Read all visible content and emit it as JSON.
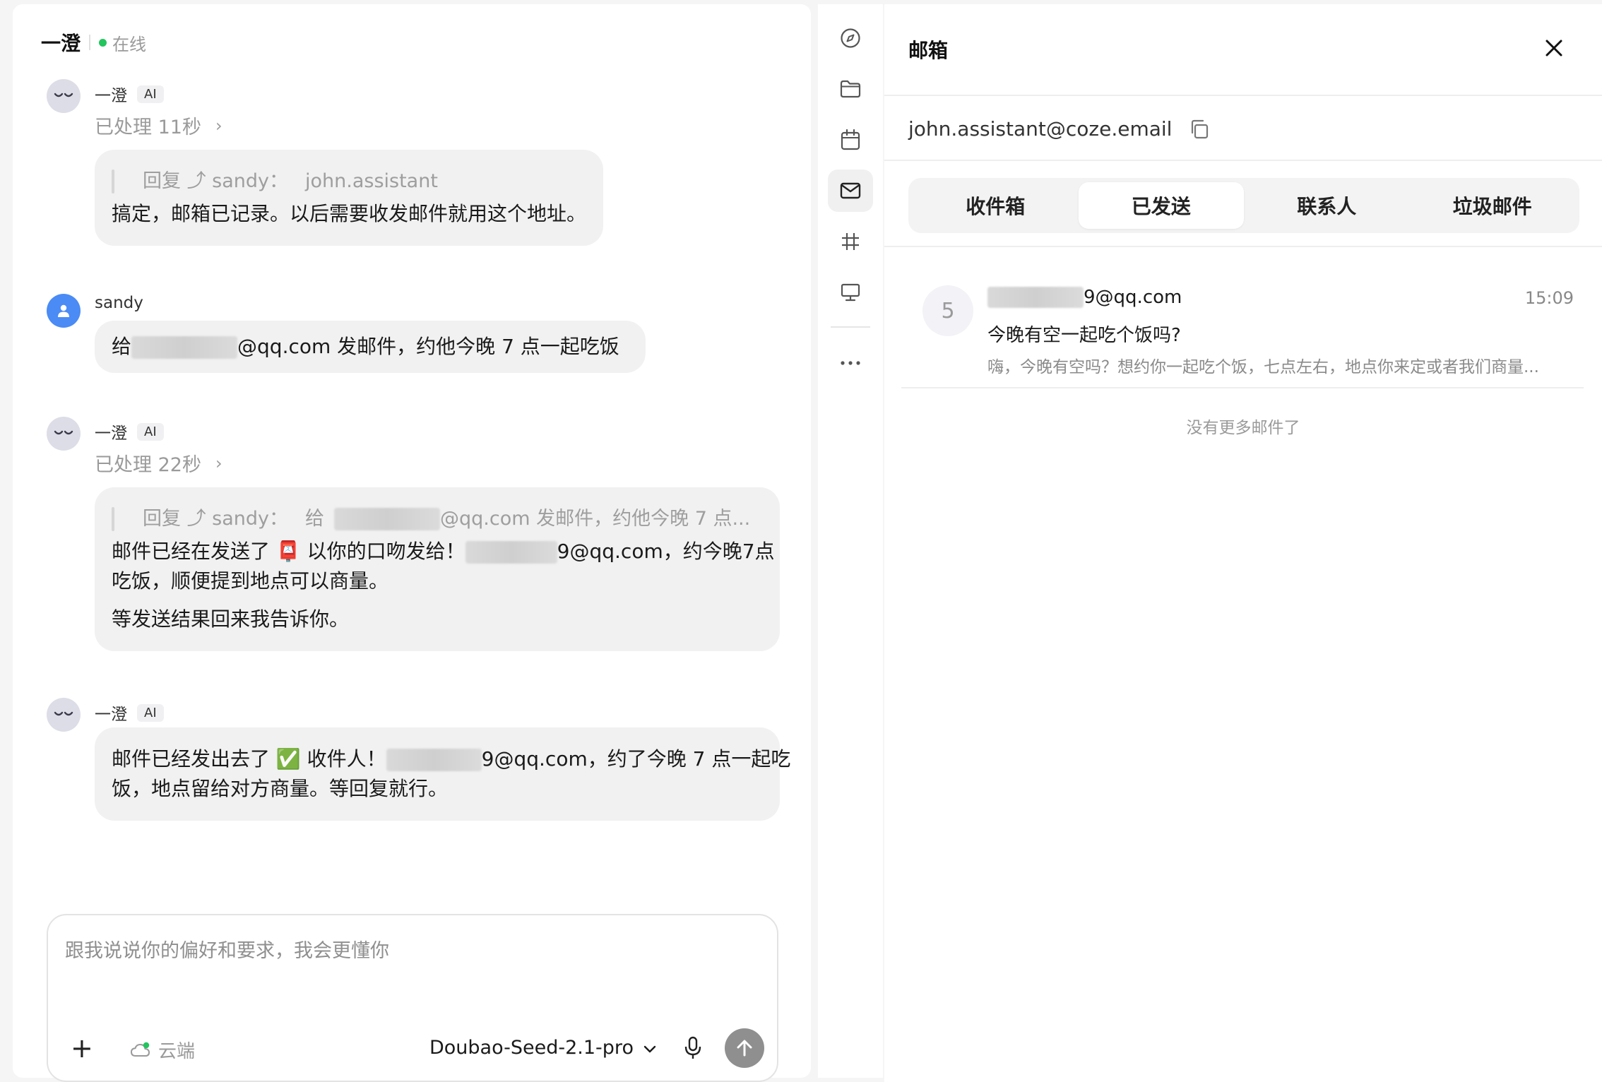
{
  "chat": {
    "title": "一澄",
    "status": "在线",
    "messages": [
      {
        "sender": "一澄",
        "badge": "AI",
        "processed": "已处理 11秒",
        "quote_prefix": "回复 ⤴ sandy：",
        "quote_text": "john.assistant",
        "lines": [
          "搞定，邮箱已记录。以后需要收发邮件就用这个地址。"
        ]
      },
      {
        "sender": "sandy",
        "text_prefix": "给",
        "text_suffix": "@qq.com 发邮件，约他今晚 7 点一起吃饭"
      },
      {
        "sender": "一澄",
        "badge": "AI",
        "processed": "已处理 22秒",
        "quote_prefix": "回复 ⤴ sandy：",
        "quote_a": "给",
        "quote_b": "@qq.com 发邮件，约他今晚 7 点...",
        "line1_a": "邮件已经在发送了 📮 以你的口吻发给！",
        "line1_b": "9@qq.com，约今晚7点",
        "line2": "吃饭，顺便提到地点可以商量。",
        "line3": "等发送结果回来我告诉你。"
      },
      {
        "sender": "一澄",
        "badge": "AI",
        "line1_a": "邮件已经发出去了 ✅ 收件人！",
        "line1_b": "9@qq.com，约了今晚 7 点一起吃",
        "line2": "饭，地点留给对方商量。等回复就行。"
      }
    ]
  },
  "composer": {
    "placeholder": "跟我说说你的偏好和要求，我会更懂你",
    "plus": "+",
    "cloud_label": "云端",
    "model": "Doubao-Seed-2.1-pro"
  },
  "rail": {
    "icons": [
      "compass-icon",
      "folder-icon",
      "calendar-icon",
      "mail-icon",
      "hash-icon",
      "presentation-icon",
      "more-icon"
    ],
    "active": "mail-icon"
  },
  "mailbox": {
    "title": "邮箱",
    "address": "john.assistant@coze.email",
    "tabs": [
      "收件箱",
      "已发送",
      "联系人",
      "垃圾邮件"
    ],
    "active_tab": "已发送",
    "emails": [
      {
        "avatar": "5",
        "from_suffix": "9@qq.com",
        "time": "15:09",
        "subject": "今晚有空一起吃个饭吗?",
        "preview": "嗨，今晚有空吗？想约你一起吃个饭，七点左右，地点你来定或者我们商量..."
      }
    ],
    "no_more": "没有更多邮件了"
  },
  "colors": {
    "online": "#22c55e",
    "user_avatar": "#4a8bf5",
    "bubble": "#f1f1f1",
    "send_button": "#8f8f8f"
  }
}
